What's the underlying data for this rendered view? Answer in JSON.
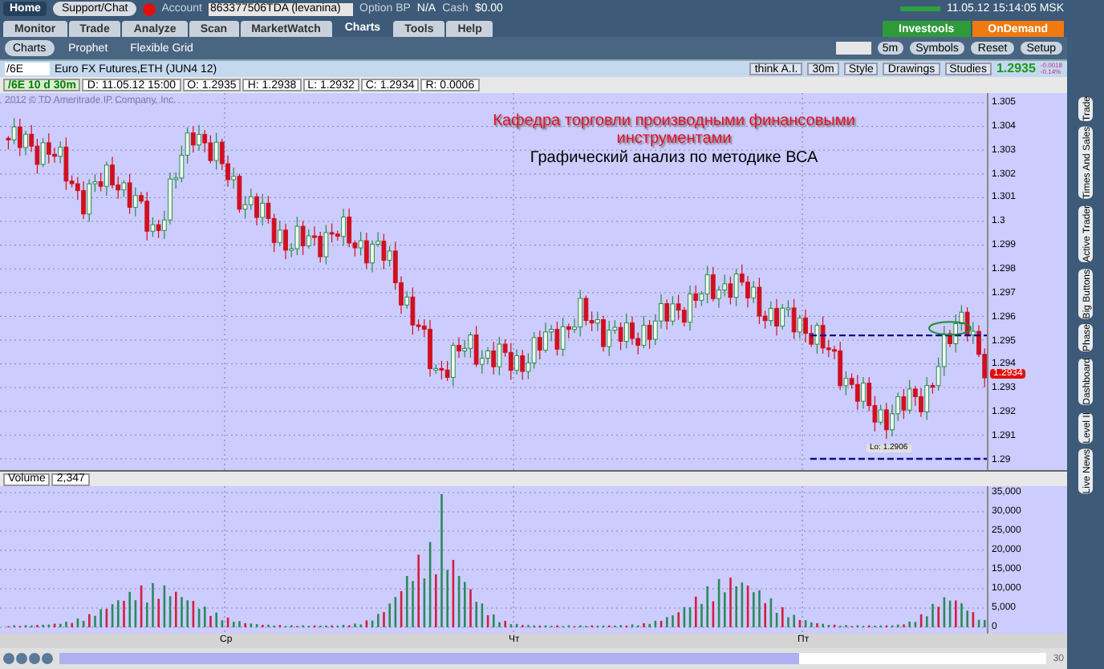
{
  "top_bar": {
    "home": "Home",
    "support": "Support/Chat",
    "account_label": "Account",
    "account_value": "863377506TDA (levanina)",
    "option_bp_label": "Option BP",
    "option_bp_value": "N/A",
    "cash_label": "Cash",
    "cash_value": "$0.00",
    "timestamp": "11.05.12 15:14:05 MSK"
  },
  "tabs": [
    {
      "label": "Monitor",
      "selected": false
    },
    {
      "label": "Trade",
      "selected": false
    },
    {
      "label": "Analyze",
      "selected": false
    },
    {
      "label": "Scan",
      "selected": false
    },
    {
      "label": "MarketWatch",
      "selected": false
    },
    {
      "label": "Charts",
      "selected": true
    },
    {
      "label": "Tools",
      "selected": false
    },
    {
      "label": "Help",
      "selected": false
    }
  ],
  "promo_buttons": [
    {
      "label": "Investools",
      "color": "#2e9a3a"
    },
    {
      "label": "OnDemand",
      "color": "#f07a10"
    }
  ],
  "subtabs": [
    {
      "label": "Charts",
      "selected": true
    },
    {
      "label": "Prophet",
      "selected": false
    },
    {
      "label": "Flexible Grid",
      "selected": false
    }
  ],
  "toolbar": {
    "period": "5m",
    "buttons": [
      "Symbols",
      "Reset",
      "Setup"
    ]
  },
  "symbol_bar": {
    "symbol": "/6E",
    "description": "Euro FX Futures,ETH (JUN4 12)",
    "tools": [
      "think A.I.",
      "30m",
      "Style",
      "Drawings",
      "Studies"
    ],
    "last": "1.2935",
    "change": "-0.0018",
    "change_pct": "-0.14%"
  },
  "info": [
    "/6E 10 d 30m",
    "D: 11.05.12 15:00",
    "O: 1.2935",
    "H: 1.2938",
    "L: 1.2932",
    "C: 1.2934",
    "R: 0.0006"
  ],
  "price_chart": {
    "copyright": "2012 © TD Ameritrade IP Company, Inc.",
    "title_lines": [
      "Кафедра торговли производными финансовыми",
      "инструментами"
    ],
    "subtitle": "Графический анализ по методике ВСА",
    "price_ticks": [
      "1.305",
      "1.304",
      "1.303",
      "1.302",
      "1.301",
      "1.3",
      "1.299",
      "1.298",
      "1.297",
      "1.296",
      "1.295",
      "1.294",
      "1.293",
      "1.292",
      "1.291",
      "1.29"
    ],
    "current_price": "1.2934",
    "low_label": "Lo: 1.2906"
  },
  "volume": {
    "label": "Volume",
    "value": "2,347",
    "ticks": [
      "35,000",
      "30,000",
      "25,000",
      "20,000",
      "15,000",
      "10,000",
      "5,000",
      "0"
    ],
    "days": [
      "Ср",
      "Чт",
      "Пт"
    ]
  },
  "bottom_bar": {
    "zoom": "30"
  },
  "side_tabs": [
    "Trade",
    "Times And Sales",
    "Active Trader",
    "Big Buttons",
    "Phase",
    "Dashboard",
    "Level II",
    "Live News"
  ]
}
